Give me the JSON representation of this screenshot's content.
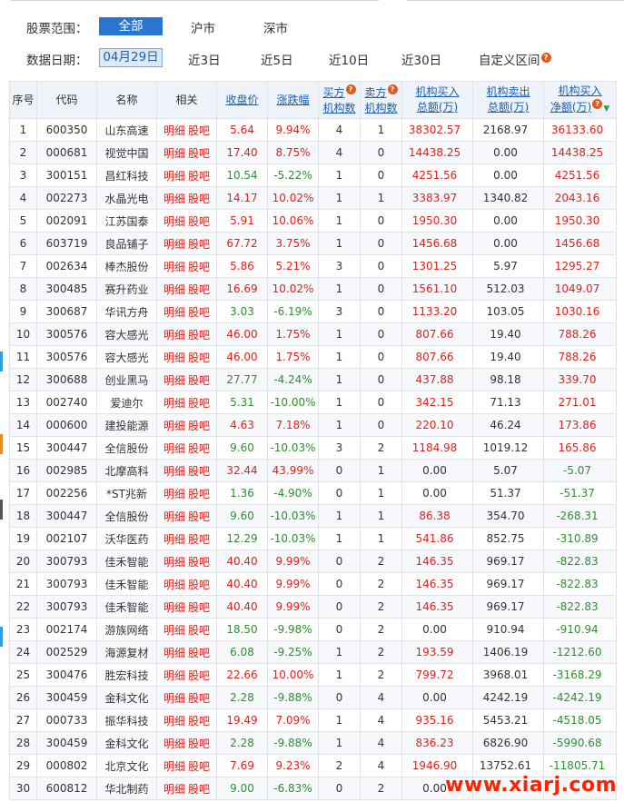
{
  "filters": {
    "scope_label": "股票范围：",
    "scope_options": [
      "全部",
      "沪市",
      "深市"
    ],
    "date_label": "数据日期：",
    "date_options": [
      "04月29日",
      "近3日",
      "近5日",
      "近10日",
      "近30日",
      "自定义区间"
    ],
    "help_glyph": "?"
  },
  "table": {
    "headers": {
      "rank": "序号",
      "code": "代码",
      "name": "名称",
      "related": "相关",
      "close": "收盘价",
      "change": "涨跌幅",
      "buy_count_l1": "买方",
      "buy_count_l2": "机构数",
      "sell_count_l1": "卖方",
      "sell_count_l2": "机构数",
      "buy_total_l1": "机构买入",
      "buy_total_l2": "总额(万)",
      "sell_total_l1": "机构卖出",
      "sell_total_l2": "总额(万)",
      "net_l1": "机构买入",
      "net_l2": "净额(万)"
    },
    "detail_label": "明细",
    "bar_label": "股吧",
    "rows": [
      {
        "rank": "1",
        "code": "600350",
        "name": "山东高速",
        "close": "5.64",
        "change": "9.94%",
        "dir": "up",
        "buyers": "4",
        "sellers": "1",
        "buy": "38302.57",
        "sell": "2168.97",
        "net": "36133.60"
      },
      {
        "rank": "2",
        "code": "000681",
        "name": "视觉中国",
        "close": "17.40",
        "change": "8.75%",
        "dir": "up",
        "buyers": "4",
        "sellers": "0",
        "buy": "14438.25",
        "sell": "0.00",
        "net": "14438.25"
      },
      {
        "rank": "3",
        "code": "300151",
        "name": "昌红科技",
        "close": "10.54",
        "change": "-5.22%",
        "dir": "down",
        "buyers": "1",
        "sellers": "0",
        "buy": "4251.56",
        "sell": "0.00",
        "net": "4251.56"
      },
      {
        "rank": "4",
        "code": "002273",
        "name": "水晶光电",
        "close": "14.17",
        "change": "10.02%",
        "dir": "up",
        "buyers": "1",
        "sellers": "1",
        "buy": "3383.97",
        "sell": "1340.82",
        "net": "2043.16"
      },
      {
        "rank": "5",
        "code": "002091",
        "name": "江苏国泰",
        "close": "5.91",
        "change": "10.06%",
        "dir": "up",
        "buyers": "1",
        "sellers": "0",
        "buy": "1950.30",
        "sell": "0.00",
        "net": "1950.30"
      },
      {
        "rank": "6",
        "code": "603719",
        "name": "良品铺子",
        "close": "67.72",
        "change": "3.75%",
        "dir": "up",
        "buyers": "1",
        "sellers": "0",
        "buy": "1456.68",
        "sell": "0.00",
        "net": "1456.68"
      },
      {
        "rank": "7",
        "code": "002634",
        "name": "棒杰股份",
        "close": "5.86",
        "change": "5.21%",
        "dir": "up",
        "buyers": "3",
        "sellers": "0",
        "buy": "1301.25",
        "sell": "5.97",
        "net": "1295.27"
      },
      {
        "rank": "8",
        "code": "300485",
        "name": "赛升药业",
        "close": "16.69",
        "change": "10.02%",
        "dir": "up",
        "buyers": "1",
        "sellers": "0",
        "buy": "1561.10",
        "sell": "512.03",
        "net": "1049.07"
      },
      {
        "rank": "9",
        "code": "300687",
        "name": "华讯方舟",
        "close": "3.03",
        "change": "-6.19%",
        "dir": "down",
        "buyers": "3",
        "sellers": "0",
        "buy": "1133.20",
        "sell": "103.05",
        "net": "1030.16"
      },
      {
        "rank": "10",
        "code": "300576",
        "name": "容大感光",
        "close": "46.00",
        "change": "1.75%",
        "dir": "up",
        "buyers": "1",
        "sellers": "0",
        "buy": "807.66",
        "sell": "19.40",
        "net": "788.26"
      },
      {
        "rank": "11",
        "code": "300576",
        "name": "容大感光",
        "close": "46.00",
        "change": "1.75%",
        "dir": "up",
        "buyers": "1",
        "sellers": "0",
        "buy": "807.66",
        "sell": "19.40",
        "net": "788.26"
      },
      {
        "rank": "12",
        "code": "300688",
        "name": "创业黑马",
        "close": "27.77",
        "change": "-4.24%",
        "dir": "down",
        "buyers": "1",
        "sellers": "0",
        "buy": "437.88",
        "sell": "98.18",
        "net": "339.70"
      },
      {
        "rank": "13",
        "code": "002740",
        "name": "爱迪尔",
        "close": "5.31",
        "change": "-10.00%",
        "dir": "down",
        "buyers": "1",
        "sellers": "0",
        "buy": "342.15",
        "sell": "71.13",
        "net": "271.01"
      },
      {
        "rank": "14",
        "code": "000600",
        "name": "建投能源",
        "close": "4.63",
        "change": "7.18%",
        "dir": "up",
        "buyers": "1",
        "sellers": "0",
        "buy": "220.10",
        "sell": "46.24",
        "net": "173.86"
      },
      {
        "rank": "15",
        "code": "300447",
        "name": "全信股份",
        "close": "9.60",
        "change": "-10.03%",
        "dir": "down",
        "buyers": "3",
        "sellers": "2",
        "buy": "1184.98",
        "sell": "1019.12",
        "net": "165.86"
      },
      {
        "rank": "16",
        "code": "002985",
        "name": "北摩高科",
        "close": "32.44",
        "change": "43.99%",
        "dir": "up",
        "buyers": "0",
        "sellers": "1",
        "buy": "0.00",
        "sell": "5.07",
        "net": "-5.07"
      },
      {
        "rank": "17",
        "code": "002256",
        "name": "*ST兆新",
        "close": "1.36",
        "change": "-4.90%",
        "dir": "down",
        "buyers": "0",
        "sellers": "1",
        "buy": "0.00",
        "sell": "51.37",
        "net": "-51.37"
      },
      {
        "rank": "18",
        "code": "300447",
        "name": "全信股份",
        "close": "9.60",
        "change": "-10.03%",
        "dir": "down",
        "buyers": "1",
        "sellers": "1",
        "buy": "86.38",
        "sell": "354.70",
        "net": "-268.31"
      },
      {
        "rank": "19",
        "code": "002107",
        "name": "沃华医药",
        "close": "12.29",
        "change": "-10.03%",
        "dir": "down",
        "buyers": "1",
        "sellers": "1",
        "buy": "541.86",
        "sell": "852.75",
        "net": "-310.89"
      },
      {
        "rank": "20",
        "code": "300793",
        "name": "佳禾智能",
        "close": "40.40",
        "change": "9.99%",
        "dir": "up",
        "buyers": "0",
        "sellers": "2",
        "buy": "146.35",
        "sell": "969.17",
        "net": "-822.83"
      },
      {
        "rank": "21",
        "code": "300793",
        "name": "佳禾智能",
        "close": "40.40",
        "change": "9.99%",
        "dir": "up",
        "buyers": "0",
        "sellers": "2",
        "buy": "146.35",
        "sell": "969.17",
        "net": "-822.83"
      },
      {
        "rank": "22",
        "code": "300793",
        "name": "佳禾智能",
        "close": "40.40",
        "change": "9.99%",
        "dir": "up",
        "buyers": "0",
        "sellers": "2",
        "buy": "146.35",
        "sell": "969.17",
        "net": "-822.83"
      },
      {
        "rank": "23",
        "code": "002174",
        "name": "游族网络",
        "close": "18.50",
        "change": "-9.98%",
        "dir": "down",
        "buyers": "0",
        "sellers": "2",
        "buy": "0.00",
        "sell": "910.94",
        "net": "-910.94"
      },
      {
        "rank": "24",
        "code": "002529",
        "name": "海源复材",
        "close": "6.08",
        "change": "-9.25%",
        "dir": "down",
        "buyers": "1",
        "sellers": "2",
        "buy": "193.59",
        "sell": "1406.19",
        "net": "-1212.60"
      },
      {
        "rank": "25",
        "code": "300476",
        "name": "胜宏科技",
        "close": "22.66",
        "change": "10.00%",
        "dir": "up",
        "buyers": "1",
        "sellers": "2",
        "buy": "799.72",
        "sell": "3968.01",
        "net": "-3168.29"
      },
      {
        "rank": "26",
        "code": "300459",
        "name": "金科文化",
        "close": "2.28",
        "change": "-9.88%",
        "dir": "down",
        "buyers": "0",
        "sellers": "4",
        "buy": "0.00",
        "sell": "4242.19",
        "net": "-4242.19"
      },
      {
        "rank": "27",
        "code": "000733",
        "name": "振华科技",
        "close": "19.49",
        "change": "7.09%",
        "dir": "up",
        "buyers": "1",
        "sellers": "4",
        "buy": "935.16",
        "sell": "5453.21",
        "net": "-4518.05"
      },
      {
        "rank": "28",
        "code": "300459",
        "name": "金科文化",
        "close": "2.28",
        "change": "-9.88%",
        "dir": "down",
        "buyers": "1",
        "sellers": "4",
        "buy": "836.23",
        "sell": "6826.90",
        "net": "-5990.68"
      },
      {
        "rank": "29",
        "code": "000802",
        "name": "北京文化",
        "close": "7.69",
        "change": "9.23%",
        "dir": "up",
        "buyers": "2",
        "sellers": "4",
        "buy": "1946.90",
        "sell": "13752.61",
        "net": "-11805.71"
      },
      {
        "rank": "30",
        "code": "600812",
        "name": "华北制药",
        "close": "9.00",
        "change": "-6.83%",
        "dir": "down",
        "buyers": "0",
        "sellers": "2",
        "buy": "0.00",
        "sell": "",
        "net": ""
      }
    ]
  },
  "watermark": "www.xiarj.com",
  "colors": {
    "accent": "#2a76cf",
    "up": "#e0221b",
    "down": "#2f8f2f",
    "header_bg": "#eef3fa"
  }
}
